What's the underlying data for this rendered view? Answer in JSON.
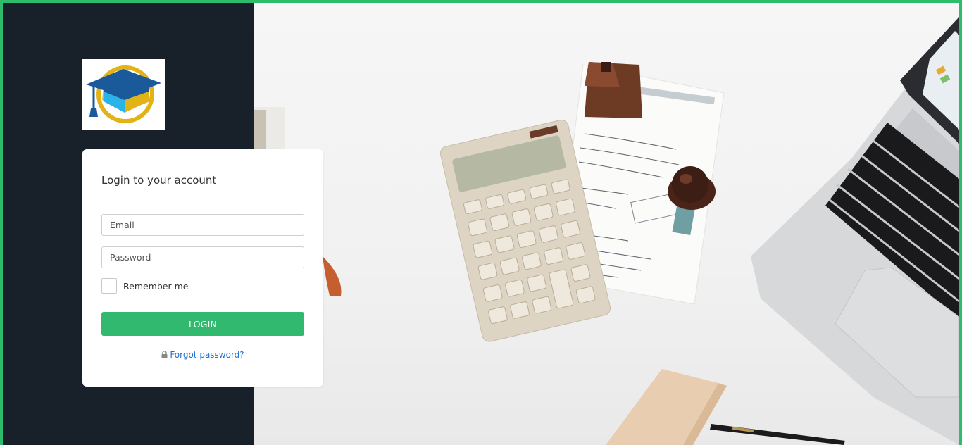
{
  "login": {
    "title": "Login to your account",
    "email_placeholder": "Email",
    "password_placeholder": "Password",
    "remember_label": "Remember me",
    "button_label": "LOGIN",
    "forgot_label": "Forgot password?"
  },
  "colors": {
    "accent": "#31ba6f",
    "frame": "#2fbb6c",
    "sidebar": "#18202a",
    "link": "#1f6fd1"
  },
  "icons": {
    "logo": "graduation-cap-logo-icon",
    "lock": "lock-icon"
  }
}
